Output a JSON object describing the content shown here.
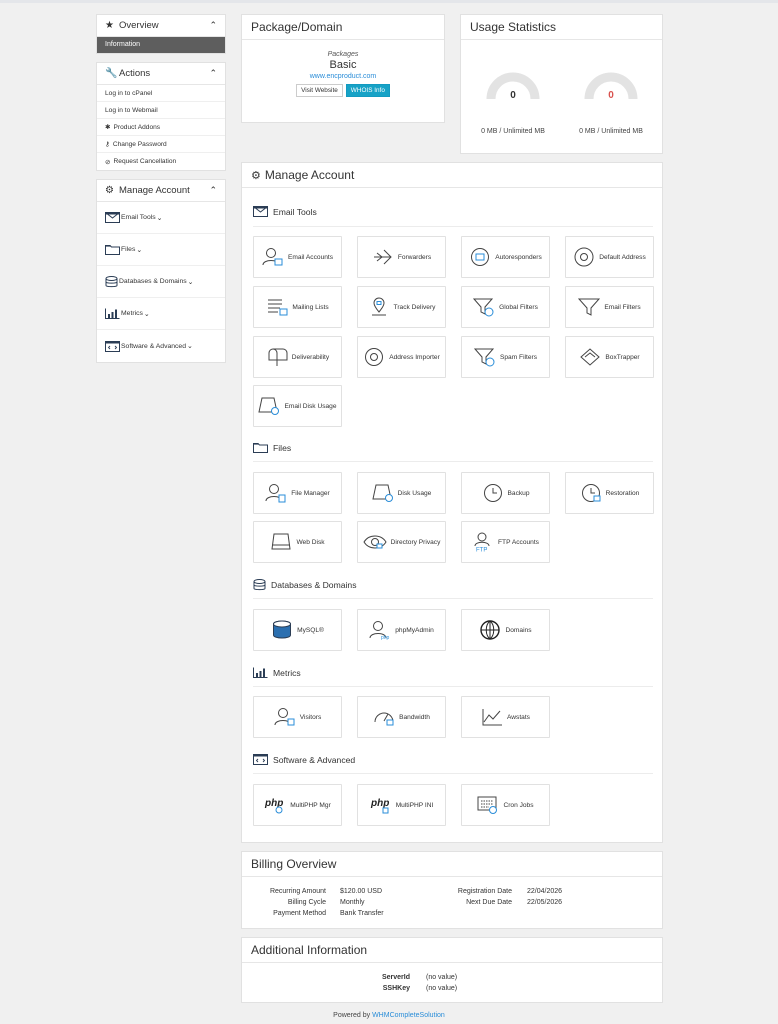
{
  "sidebar": {
    "overview": {
      "title": "Overview",
      "items": [
        "Information"
      ]
    },
    "actions": {
      "title": "Actions",
      "items": [
        "Log in to cPanel",
        "Log in to Webmail",
        "Product Addons",
        "Change Password",
        "Request Cancellation"
      ]
    },
    "manage": {
      "title": "Manage Account",
      "items": [
        "Email Tools",
        "Files",
        "Databases & Domains",
        "Metrics",
        "Software & Advanced"
      ]
    }
  },
  "package": {
    "title": "Package/Domain",
    "label": "Packages",
    "name": "Basic",
    "domain": "www.encproduct.com",
    "visit_label": "Visit Website",
    "whois_label": "WHOIS Info"
  },
  "usage": {
    "title": "Usage Statistics",
    "disk": {
      "value": "0",
      "caption": "0 MB / Unlimited MB",
      "fraction": 0
    },
    "bandwidth": {
      "value": "0",
      "caption": "0 MB / Unlimited MB",
      "fraction": 0
    },
    "colors": {
      "normal": "#333333",
      "alert": "#d9534f"
    }
  },
  "manage": {
    "title": "Manage Account",
    "sections": {
      "email": {
        "title": "Email Tools",
        "tiles": [
          "Email Accounts",
          "Forwarders",
          "Autoresponders",
          "Default Address",
          "Mailing Lists",
          "Track Delivery",
          "Global Filters",
          "Email Filters",
          "Deliverability",
          "Address Importer",
          "Spam Filters",
          "BoxTrapper",
          "Email Disk Usage"
        ]
      },
      "files": {
        "title": "Files",
        "tiles": [
          "File Manager",
          "Disk Usage",
          "Backup",
          "Restoration",
          "Web Disk",
          "Directory Privacy",
          "FTP Accounts"
        ]
      },
      "db": {
        "title": "Databases & Domains",
        "tiles": [
          "MySQL®",
          "phpMyAdmin",
          "Domains"
        ]
      },
      "metrics": {
        "title": "Metrics",
        "tiles": [
          "Visitors",
          "Bandwidth",
          "Awstats"
        ]
      },
      "software": {
        "title": "Software & Advanced",
        "tiles": [
          "MultiPHP Mgr",
          "MultiPHP INI",
          "Cron Jobs"
        ]
      }
    }
  },
  "billing": {
    "title": "Billing Overview",
    "recurring_label": "Recurring Amount",
    "recurring_value": "$120.00 USD",
    "cycle_label": "Billing Cycle",
    "cycle_value": "Monthly",
    "method_label": "Payment Method",
    "method_value": "Bank Transfer",
    "reg_label": "Registration Date",
    "reg_value": "22/04/2026",
    "due_label": "Next Due Date",
    "due_value": "22/05/2026"
  },
  "additional": {
    "title": "Additional Information",
    "serverid_label": "ServerId",
    "serverid_value": "(no value)",
    "sshkey_label": "SSHKey",
    "sshkey_value": "(no value)"
  },
  "footer": {
    "prefix": "Powered by",
    "link": "WHMCompleteSolution"
  },
  "colors": {
    "accent": "#2a8dd8",
    "button_info": "#17a2c6",
    "active_nav": "#5e5e5e"
  }
}
